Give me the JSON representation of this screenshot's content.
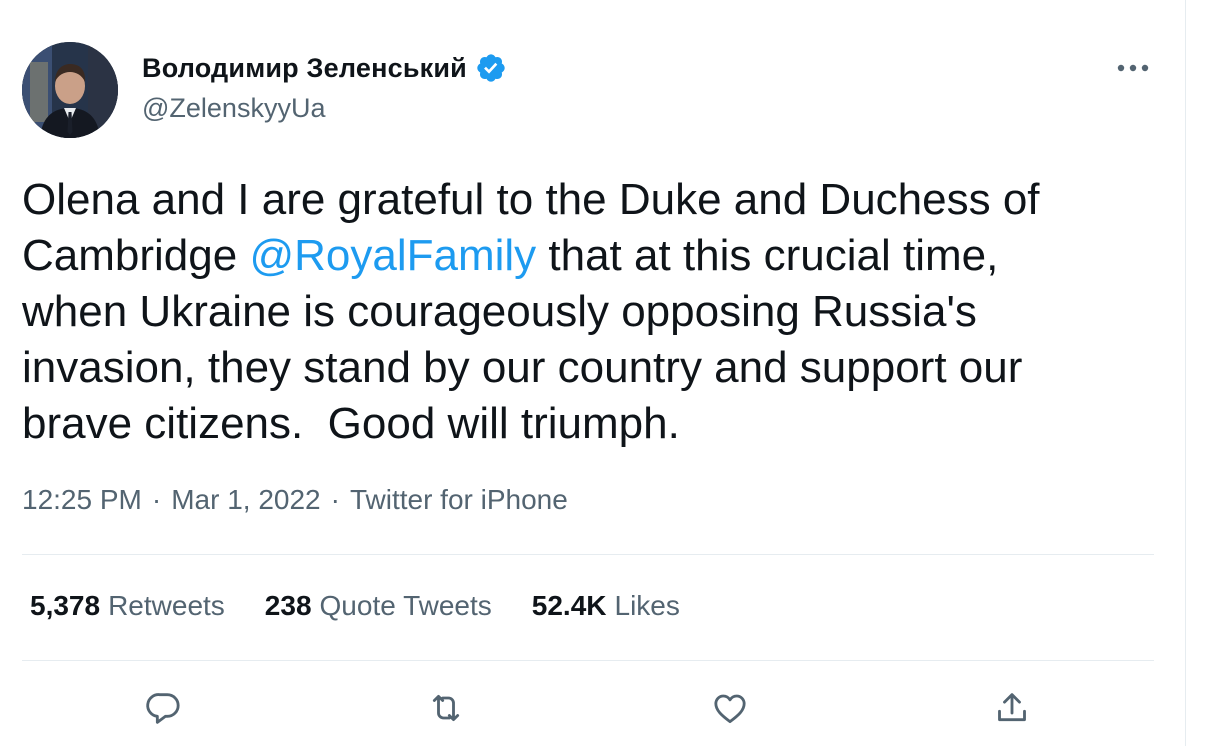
{
  "author": {
    "display_name": "Володимир Зеленський",
    "handle": "@ZelenskyyUa",
    "verified": true
  },
  "tweet": {
    "text_before": "Olena and I are grateful to the Duke and Duchess of\nCambridge ",
    "mention": "@RoyalFamily",
    "text_after": " that at this crucial time,\nwhen Ukraine is courageously opposing Russia's\ninvasion, they stand by our country and support our\nbrave citizens.  Good will triumph."
  },
  "meta": {
    "time": "12:25 PM",
    "separator": "·",
    "date": "Mar 1, 2022",
    "source": "Twitter for iPhone"
  },
  "stats": {
    "retweets_count": "5,378",
    "retweets_label": "Retweets",
    "quotes_count": "238",
    "quotes_label": "Quote Tweets",
    "likes_count": "52.4K",
    "likes_label": "Likes"
  },
  "icons": {
    "more": "more-horizontal-icon",
    "verified": "verified-badge-icon",
    "reply": "reply-icon",
    "retweet": "retweet-icon",
    "like": "heart-icon",
    "share": "share-icon"
  },
  "colors": {
    "accent": "#1d9bf0",
    "text": "#0f1419",
    "secondary": "#536471",
    "divider": "#e6ecf0"
  }
}
